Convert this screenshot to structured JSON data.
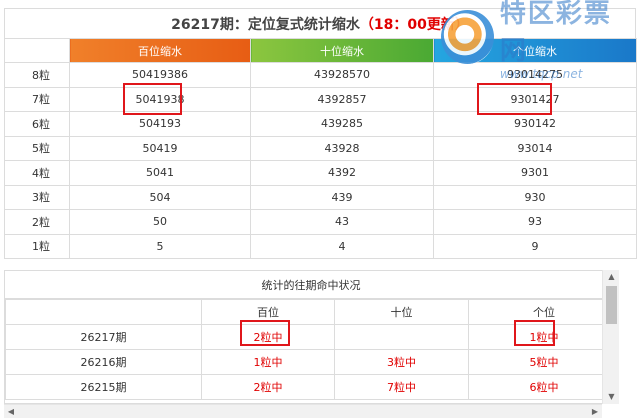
{
  "title": {
    "main": "26217期：定位复式统计缩水",
    "update": "（18：00更新）"
  },
  "logo": {
    "name": "特区彩票网",
    "url": "www.tqcp.net"
  },
  "columns": {
    "bai": "百位缩水",
    "shi": "十位缩水",
    "ge": "个位缩水"
  },
  "rows": [
    {
      "label": "8粒",
      "bai": "50419386",
      "shi": "43928570",
      "ge": "93014275"
    },
    {
      "label": "7粒",
      "bai": "5041938",
      "shi": "4392857",
      "ge": "9301427"
    },
    {
      "label": "6粒",
      "bai": "504193",
      "shi": "439285",
      "ge": "930142"
    },
    {
      "label": "5粒",
      "bai": "50419",
      "shi": "43928",
      "ge": "93014"
    },
    {
      "label": "4粒",
      "bai": "5041",
      "shi": "4392",
      "ge": "9301"
    },
    {
      "label": "3粒",
      "bai": "504",
      "shi": "439",
      "ge": "930"
    },
    {
      "label": "2粒",
      "bai": "50",
      "shi": "43",
      "ge": "93"
    },
    {
      "label": "1粒",
      "bai": "5",
      "shi": "4",
      "ge": "9"
    }
  ],
  "history": {
    "title": "统计的往期命中状况",
    "headers": [
      "",
      "百位",
      "十位",
      "个位"
    ],
    "rows": [
      {
        "period": "26217期",
        "bai": "2粒中",
        "shi": "",
        "ge": "1粒中"
      },
      {
        "period": "26216期",
        "bai": "1粒中",
        "shi": "3粒中",
        "ge": "5粒中"
      },
      {
        "period": "26215期",
        "bai": "2粒中",
        "shi": "7粒中",
        "ge": "6粒中"
      }
    ]
  },
  "colors": {
    "accent_red": "#e00000",
    "box_red": "#e0161b",
    "bai": "#e75d14",
    "shi": "#4aa933",
    "ge": "#1a78c9"
  }
}
